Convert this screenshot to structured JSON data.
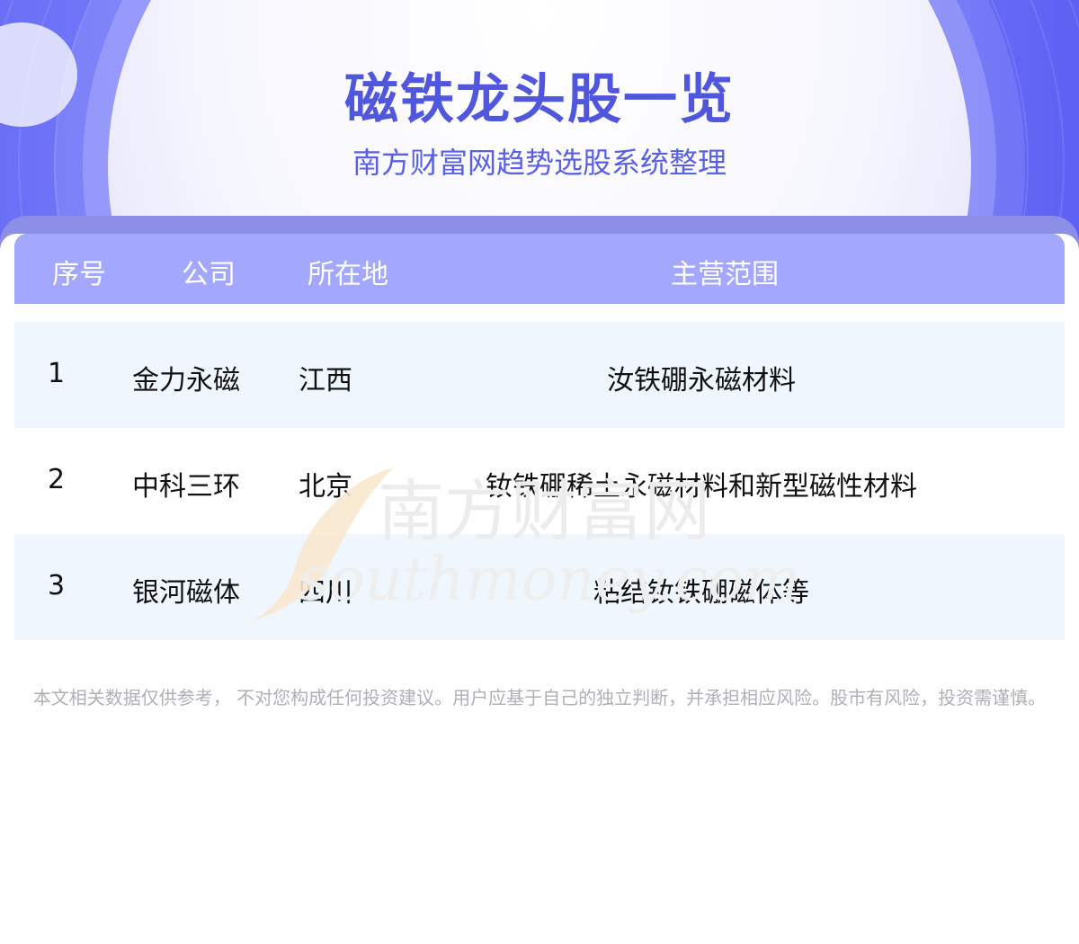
{
  "header": {
    "title": "磁铁龙头股一览",
    "subtitle": "南方财富网趋势选股系统整理"
  },
  "table": {
    "columns": [
      "序号",
      "公司",
      "所在地",
      "主营范围"
    ],
    "rows": [
      {
        "index": "1",
        "company": "金力永磁",
        "location": "江西",
        "business": "汝铁硼永磁材料"
      },
      {
        "index": "2",
        "company": "中科三环",
        "location": "北京",
        "business": "钕铁硼稀土永磁材料和新型磁性材料"
      },
      {
        "index": "3",
        "company": "银河磁体",
        "location": "四川",
        "business": "粘结钕铁硼磁体等"
      }
    ]
  },
  "watermark": {
    "cn": "南方财富网",
    "en": "southmoney.com"
  },
  "disclaimer": "本文相关数据仅供参考， 不对您构成任何投资建议。用户应基于自己的独立判断，并承担相应风险。股市有风险，投资需谨慎。",
  "colors": {
    "hero_blue": "#7a7efc",
    "title_blue": "#5057dd",
    "table_header": "#a3a8fe",
    "row_shade": "#eff6fe",
    "disclaimer_gray": "#aeb0b6"
  }
}
